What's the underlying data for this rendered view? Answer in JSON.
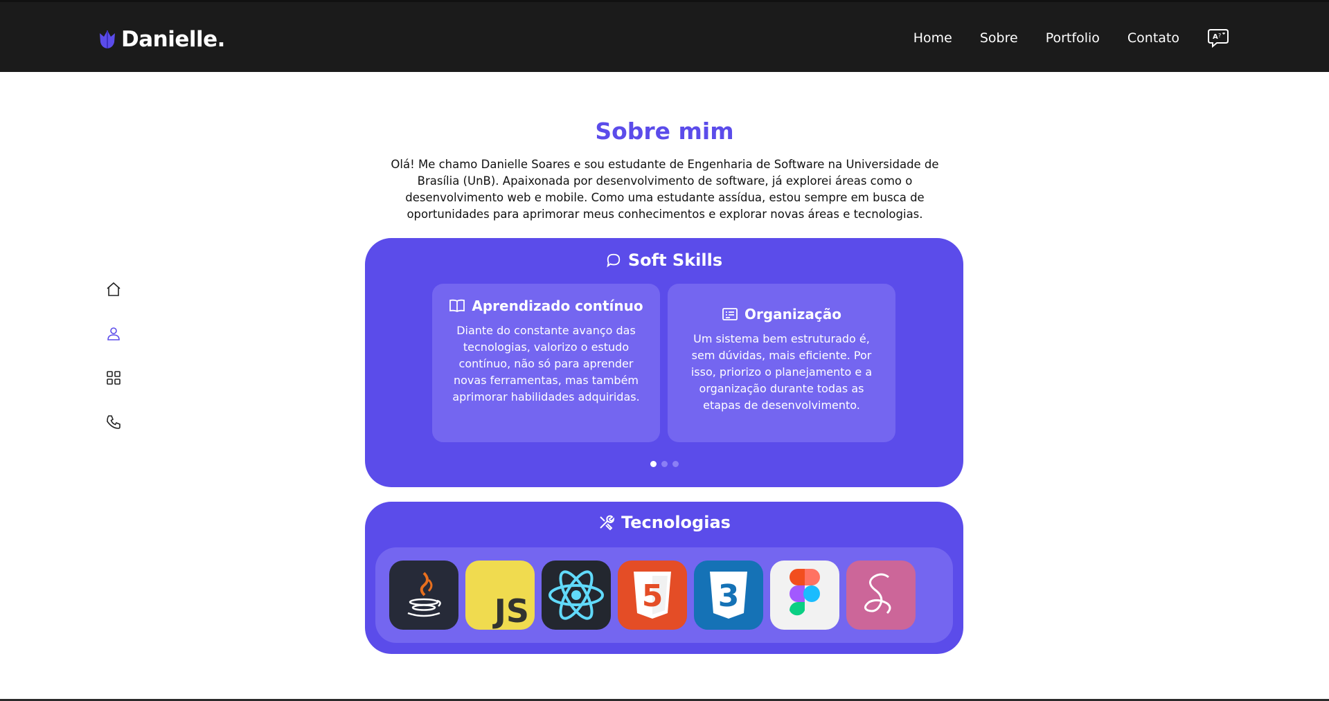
{
  "brand": {
    "name": "Danielle.",
    "accent": "#5b4cea"
  },
  "nav": {
    "items": [
      {
        "label": "Home"
      },
      {
        "label": "Sobre"
      },
      {
        "label": "Portfolio"
      },
      {
        "label": "Contato"
      }
    ],
    "language_icon": "translate-icon"
  },
  "sidenav": {
    "items": [
      {
        "icon": "home-icon",
        "active": false
      },
      {
        "icon": "user-icon",
        "active": true
      },
      {
        "icon": "grid-icon",
        "active": false
      },
      {
        "icon": "phone-icon",
        "active": false
      }
    ]
  },
  "about": {
    "title": "Sobre mim",
    "intro": "Olá! Me chamo Danielle Soares e sou estudante de Engenharia de Software na Universidade de Brasília (UnB). Apaixonada por desenvolvimento de software, já explorei áreas como o desenvolvimento web e mobile. Como uma estudante assídua, estou sempre em busca de oportunidades para aprimorar meus conhecimentos e explorar novas áreas e tecnologias."
  },
  "soft_skills": {
    "title": "Soft Skills",
    "icon": "chat-bubble-icon",
    "cards": [
      {
        "icon": "book-icon",
        "title": "Aprendizado contínuo",
        "body": "Diante do constante avanço das tecnologias, valorizo o estudo contínuo, não só para aprender novas ferramentas, mas também aprimorar habilidades adquiridas."
      },
      {
        "icon": "list-card-icon",
        "title": "Organização",
        "body": "Um sistema bem estruturado é, sem dúvidas, mais eficiente. Por isso, priorizo o planejamento e a organização durante todas as etapas de desenvolvimento."
      }
    ],
    "pagination": {
      "total": 3,
      "current": 1
    }
  },
  "technologies": {
    "title": "Tecnologias",
    "icon": "tools-icon",
    "items": [
      {
        "icon": "java-icon",
        "text": ""
      },
      {
        "icon": "javascript-icon",
        "text": "JS"
      },
      {
        "icon": "react-icon",
        "text": ""
      },
      {
        "icon": "html5-icon",
        "text": "5"
      },
      {
        "icon": "css3-icon",
        "text": "3"
      },
      {
        "icon": "figma-icon",
        "text": ""
      },
      {
        "icon": "sass-icon",
        "text": ""
      }
    ]
  }
}
